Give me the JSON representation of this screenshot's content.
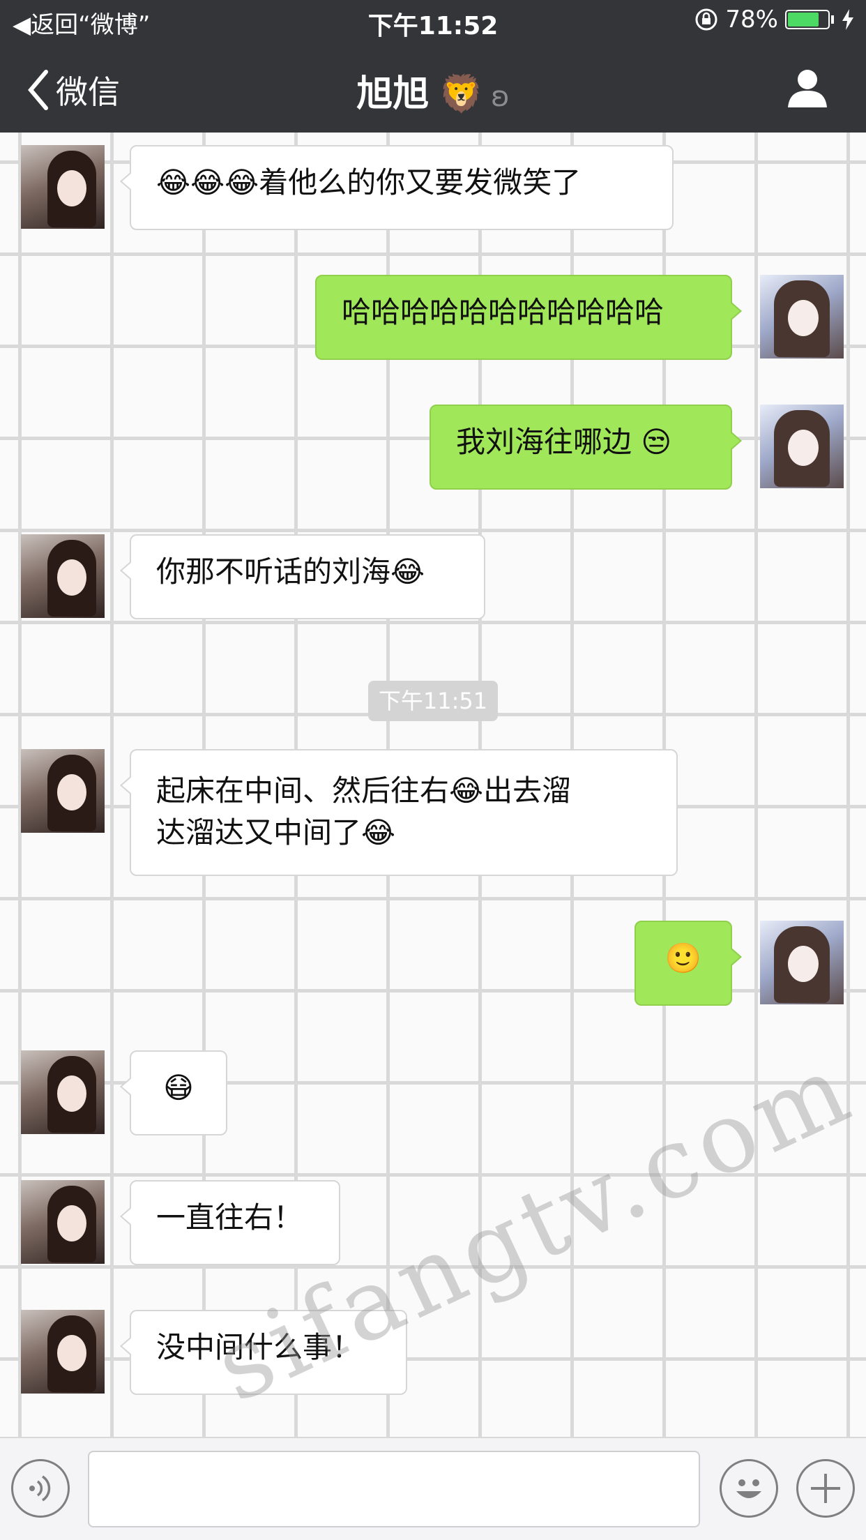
{
  "status_bar": {
    "back_app": "返回“微博”",
    "time": "下午11:52",
    "battery_percent": "78%",
    "battery_level": 0.78
  },
  "nav": {
    "back_label": "微信",
    "title": "旭旭",
    "title_emoji": "🦁",
    "earpiece_icon": "ear-icon"
  },
  "messages": [
    {
      "side": "in",
      "text": "😂😂😂着他么的你又要发微笑了"
    },
    {
      "side": "out",
      "text": "哈哈哈哈哈哈哈哈哈哈哈"
    },
    {
      "side": "out",
      "text": "我刘海往哪边 😒"
    },
    {
      "side": "in",
      "text": "你那不听话的刘海😂"
    },
    {
      "side": "in",
      "text_line1": "起床在中间、然后往右😂出去溜",
      "text_line2": "达溜达又中间了😂"
    },
    {
      "side": "out",
      "text": "🙂"
    },
    {
      "side": "in",
      "text": "😷"
    },
    {
      "side": "in",
      "text": "一直往右！"
    },
    {
      "side": "in",
      "text": "没中间什么事！"
    }
  ],
  "timestamp": "下午11:51",
  "watermark": "sifangtv.com",
  "colors": {
    "bar_bg": "#333538",
    "outgoing_bubble": "#a0e75a",
    "incoming_bubble": "#ffffff"
  }
}
